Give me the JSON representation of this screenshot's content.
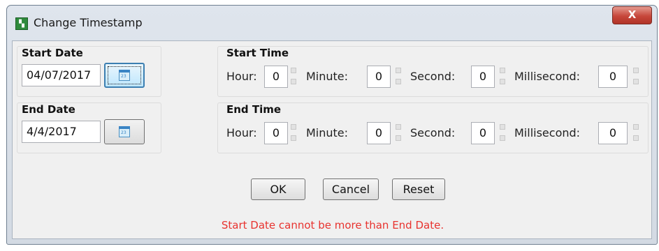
{
  "window": {
    "title": "Change Timestamp",
    "close_glyph": "X",
    "app_icon_glyph": "% "
  },
  "start_date": {
    "label": "Start Date",
    "value": "04/07/2017"
  },
  "end_date": {
    "label": "End Date",
    "value": "4/4/2017"
  },
  "start_time": {
    "label": "Start Time",
    "hour_label": "Hour:",
    "hour": "0",
    "minute_label": "Minute:",
    "minute": "0",
    "second_label": "Second:",
    "second": "0",
    "millisecond_label": "Millisecond:",
    "millisecond": "0"
  },
  "end_time": {
    "label": "End Time",
    "hour_label": "Hour:",
    "hour": "0",
    "minute_label": "Minute:",
    "minute": "0",
    "second_label": "Second:",
    "second": "0",
    "millisecond_label": "Millisecond:",
    "millisecond": "0"
  },
  "buttons": {
    "ok": "OK",
    "cancel": "Cancel",
    "reset": "Reset"
  },
  "error": "Start Date cannot be more than End Date.",
  "colors": {
    "error": "#e8332f",
    "close_button": "#c6463a",
    "focus_border": "#3c7fb1"
  },
  "icons": {
    "app": "app-logo-icon",
    "calendar": "calendar-icon",
    "close": "close-icon"
  }
}
